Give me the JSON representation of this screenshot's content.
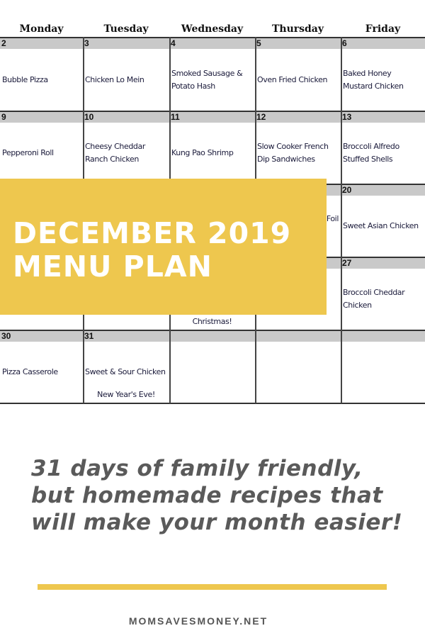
{
  "calendar": {
    "days": [
      "Monday",
      "Tuesday",
      "Wednesday",
      "Thursday",
      "Friday"
    ],
    "weeks": [
      [
        {
          "num": "2",
          "meal": "Bubble Pizza"
        },
        {
          "num": "3",
          "meal": "Chicken Lo Mein"
        },
        {
          "num": "4",
          "meal": "Smoked Sausage & Potato Hash"
        },
        {
          "num": "5",
          "meal": "Oven Fried Chicken"
        },
        {
          "num": "6",
          "meal": "Baked Honey Mustard Chicken"
        }
      ],
      [
        {
          "num": "9",
          "meal": "Pepperoni Roll"
        },
        {
          "num": "10",
          "meal": "Cheesy Cheddar Ranch Chicken"
        },
        {
          "num": "11",
          "meal": "Kung Pao Shrimp"
        },
        {
          "num": "12",
          "meal": "Slow Cooker French Dip Sandwiches"
        },
        {
          "num": "13",
          "meal": "Broccoli Alfredo Stuffed Shells"
        }
      ],
      [
        {
          "num": "",
          "meal": ""
        },
        {
          "num": "",
          "meal": ""
        },
        {
          "num": "",
          "meal": ""
        },
        {
          "num": "",
          "meal": "Foil"
        },
        {
          "num": "20",
          "meal": "Sweet Asian Chicken"
        }
      ],
      [
        {
          "num": "",
          "meal": ""
        },
        {
          "num": "",
          "meal": ""
        },
        {
          "num": "",
          "meal": "",
          "note": "Christmas!"
        },
        {
          "num": "",
          "meal": ""
        },
        {
          "num": "27",
          "meal": "Broccoli Cheddar Chicken"
        }
      ],
      [
        {
          "num": "30",
          "meal": "Pizza Casserole"
        },
        {
          "num": "31",
          "meal": "Sweet & Sour Chicken",
          "note": "New Year's Eve!"
        },
        {
          "num": "",
          "meal": ""
        },
        {
          "num": "",
          "meal": ""
        },
        {
          "num": "",
          "meal": ""
        }
      ]
    ]
  },
  "banner": {
    "title_line1": "DECEMBER 2019",
    "title_line2": "MENU PLAN",
    "color": "#eec74e"
  },
  "tagline": "31 days of family friendly, but homemade recipes that will make your month easier!",
  "site": "MOMSAVESMONEY.NET"
}
